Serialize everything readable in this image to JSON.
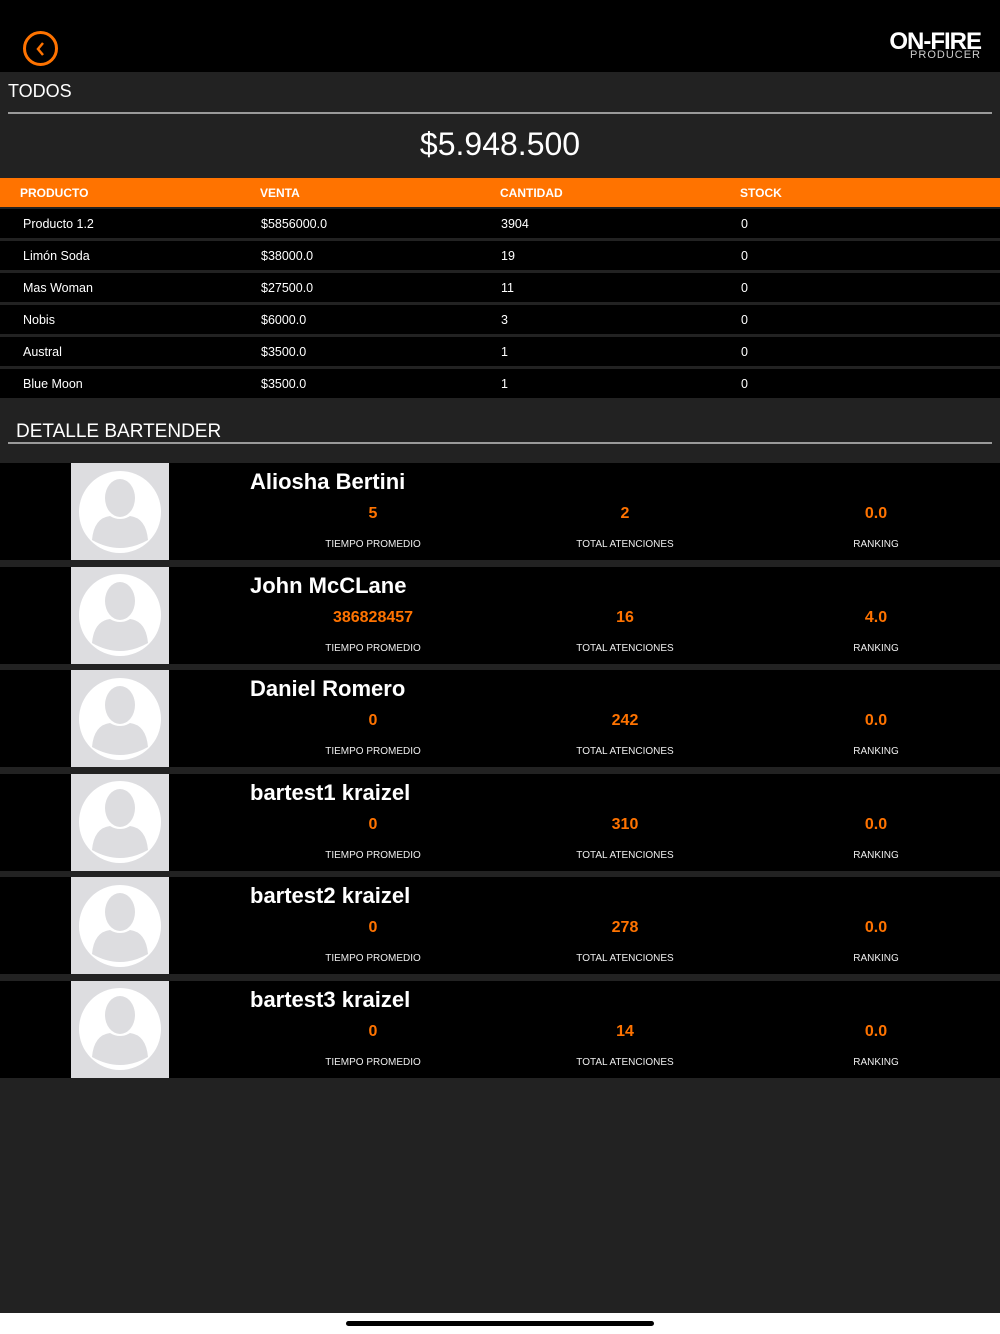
{
  "header": {
    "logo_main": "ON-FIRE",
    "logo_sub": "PRODUCER"
  },
  "filter_title": "TODOS",
  "total": "$5.948.500",
  "table": {
    "columns": [
      "PRODUCTO",
      "VENTA",
      "CANTIDAD",
      "STOCK"
    ],
    "rows": [
      [
        "Producto 1.2",
        "$5856000.0",
        "3904",
        "0"
      ],
      [
        "Limón Soda",
        "$38000.0",
        "19",
        "0"
      ],
      [
        "Mas Woman",
        "$27500.0",
        "11",
        "0"
      ],
      [
        "Nobis",
        "$6000.0",
        "3",
        "0"
      ],
      [
        "Austral",
        "$3500.0",
        "1",
        "0"
      ],
      [
        "Blue Moon",
        "$3500.0",
        "1",
        "0"
      ]
    ]
  },
  "detail_title": "DETALLE BARTENDER",
  "labels": {
    "tiempo": "TIEMPO PROMEDIO",
    "atenciones": "TOTAL ATENCIONES",
    "ranking": "RANKING"
  },
  "bartenders": [
    {
      "name": "Aliosha Bertini",
      "tiempo": "5",
      "atenciones": "2",
      "ranking": "0.0"
    },
    {
      "name": "John McCLane",
      "tiempo": "386828457",
      "atenciones": "16",
      "ranking": "4.0"
    },
    {
      "name": "Daniel Romero",
      "tiempo": "0",
      "atenciones": "242",
      "ranking": "0.0"
    },
    {
      "name": "bartest1 kraizel",
      "tiempo": "0",
      "atenciones": "310",
      "ranking": "0.0"
    },
    {
      "name": "bartest2 kraizel",
      "tiempo": "0",
      "atenciones": "278",
      "ranking": "0.0"
    },
    {
      "name": "bartest3 kraizel",
      "tiempo": "0",
      "atenciones": "14",
      "ranking": "0.0"
    }
  ]
}
